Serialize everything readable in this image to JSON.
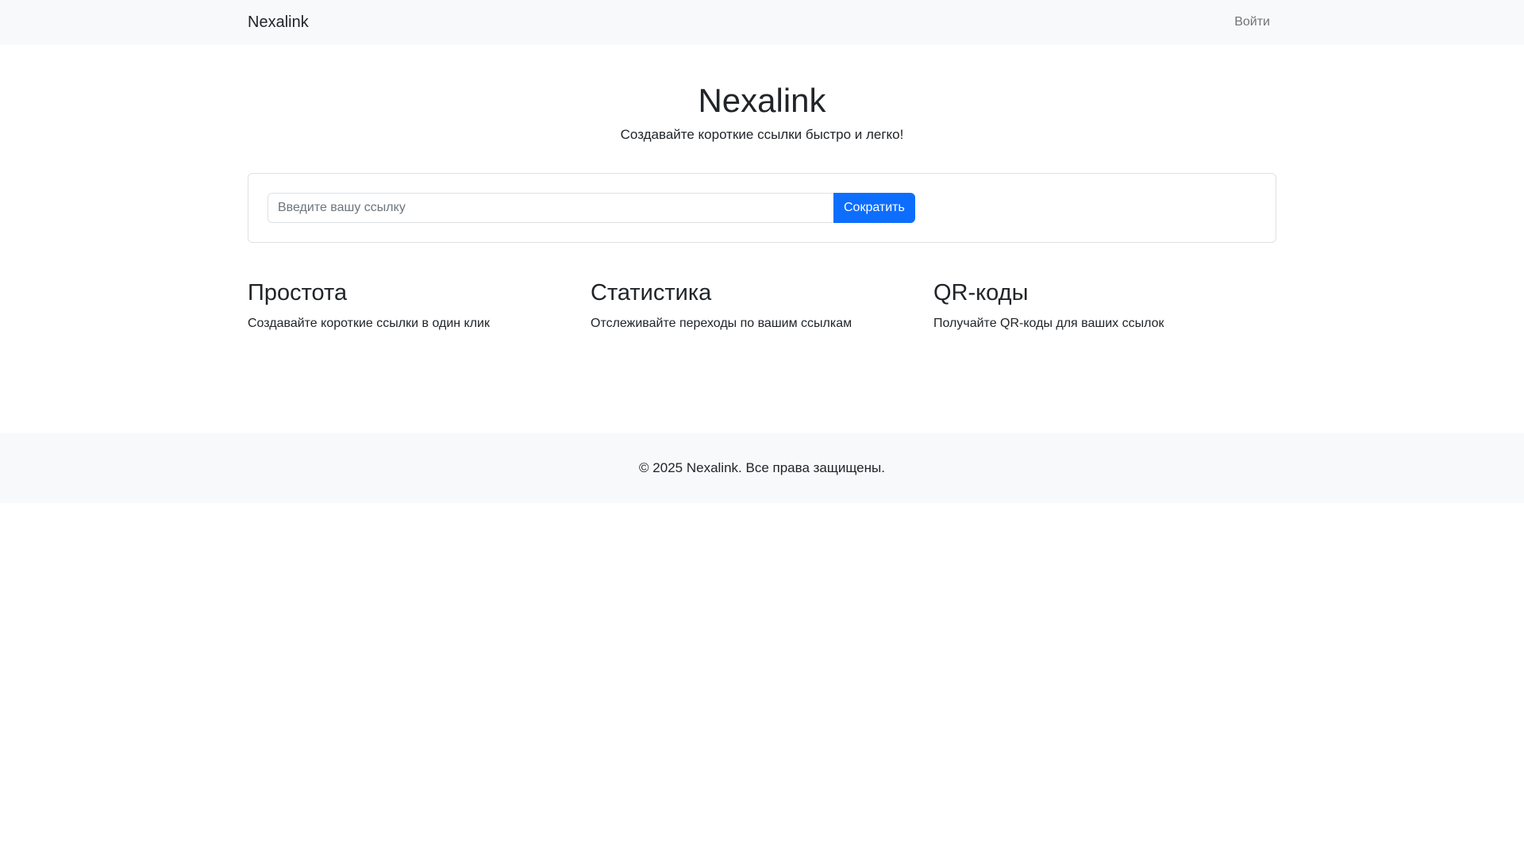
{
  "navbar": {
    "brand": "Nexalink",
    "login_label": "Войти"
  },
  "hero": {
    "title": "Nexalink",
    "subtitle": "Создавайте короткие ссылки быстро и легко!"
  },
  "shortener": {
    "placeholder": "Введите вашу ссылку",
    "value": "",
    "button_label": "Сократить"
  },
  "features": [
    {
      "title": "Простота",
      "text": "Создавайте короткие ссылки в один клик"
    },
    {
      "title": "Статистика",
      "text": "Отслеживайте переходы по вашим ссылкам"
    },
    {
      "title": "QR-коды",
      "text": "Получайте QR-коды для ваших ссылок"
    }
  ],
  "footer": {
    "text": "© 2025 Nexalink. Все права защищены."
  },
  "colors": {
    "navbar_bg": "#f8f9fa",
    "primary": "#0d6efd",
    "text": "#212529",
    "muted_link": "#6c757d"
  }
}
